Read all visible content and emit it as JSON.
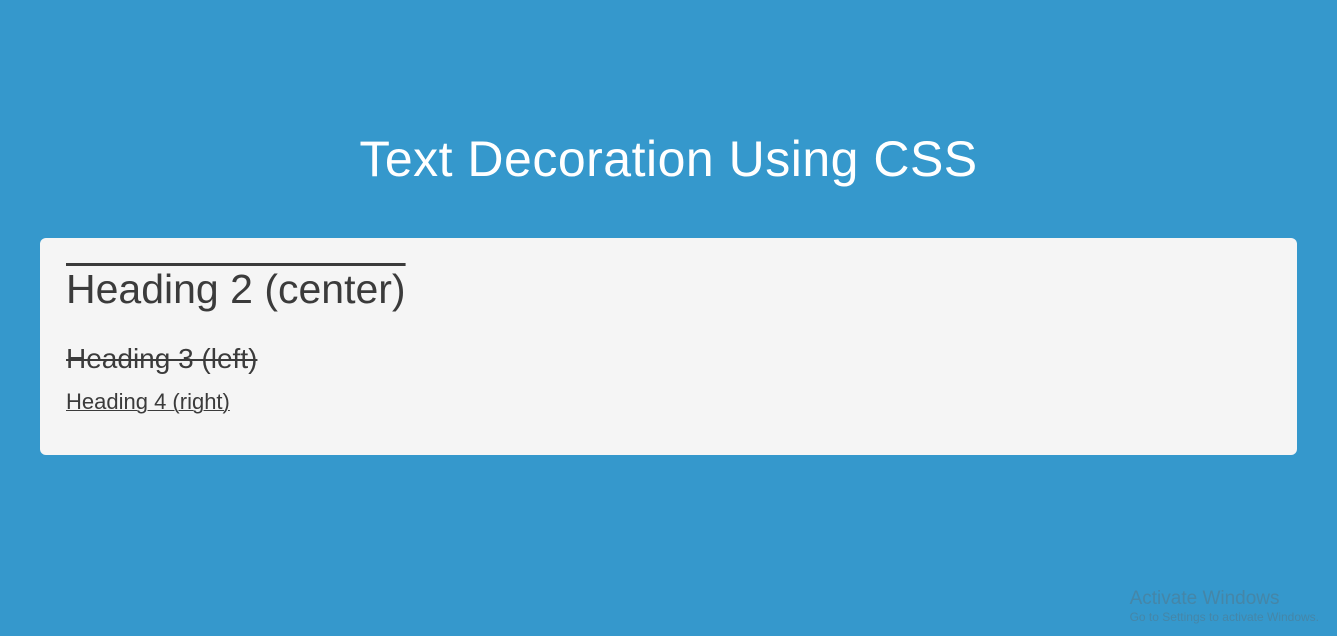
{
  "page": {
    "title": "Text Decoration Using CSS"
  },
  "content": {
    "heading2": "Heading 2 (center)",
    "heading3": "Heading 3 (left)",
    "heading4": "Heading 4 (right)"
  },
  "watermark": {
    "line1": "Activate Windows",
    "line2": "Go to Settings to activate Windows."
  }
}
